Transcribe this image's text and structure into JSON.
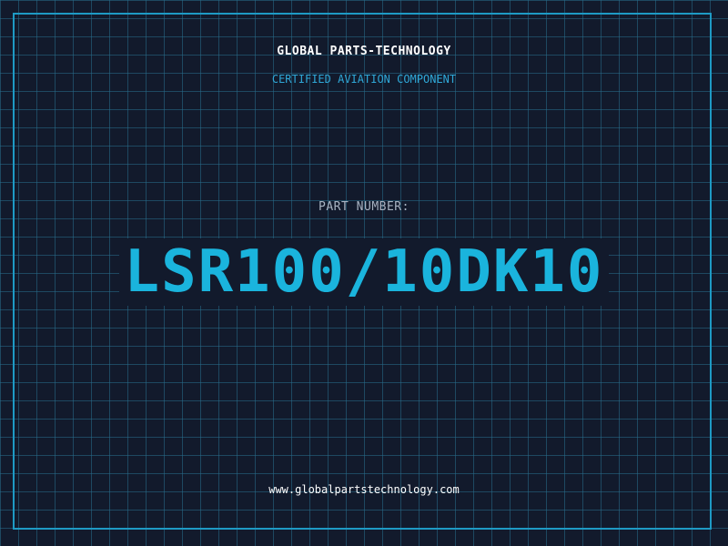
{
  "colors": {
    "background": "#121a2c",
    "grid": "#286e8c",
    "frame": "#1e9ac4",
    "accent": "#1ab4dd",
    "subtitle": "#2fa8d8",
    "label": "#a8b3c2",
    "text": "#ffffff"
  },
  "header": {
    "company": "GLOBAL PARTS-TECHNOLOGY",
    "subtitle": "CERTIFIED AVIATION COMPONENT"
  },
  "part": {
    "label": "PART NUMBER:",
    "number": "LSR100/10DK10"
  },
  "footer": {
    "website": "www.globalpartstechnology.com"
  }
}
